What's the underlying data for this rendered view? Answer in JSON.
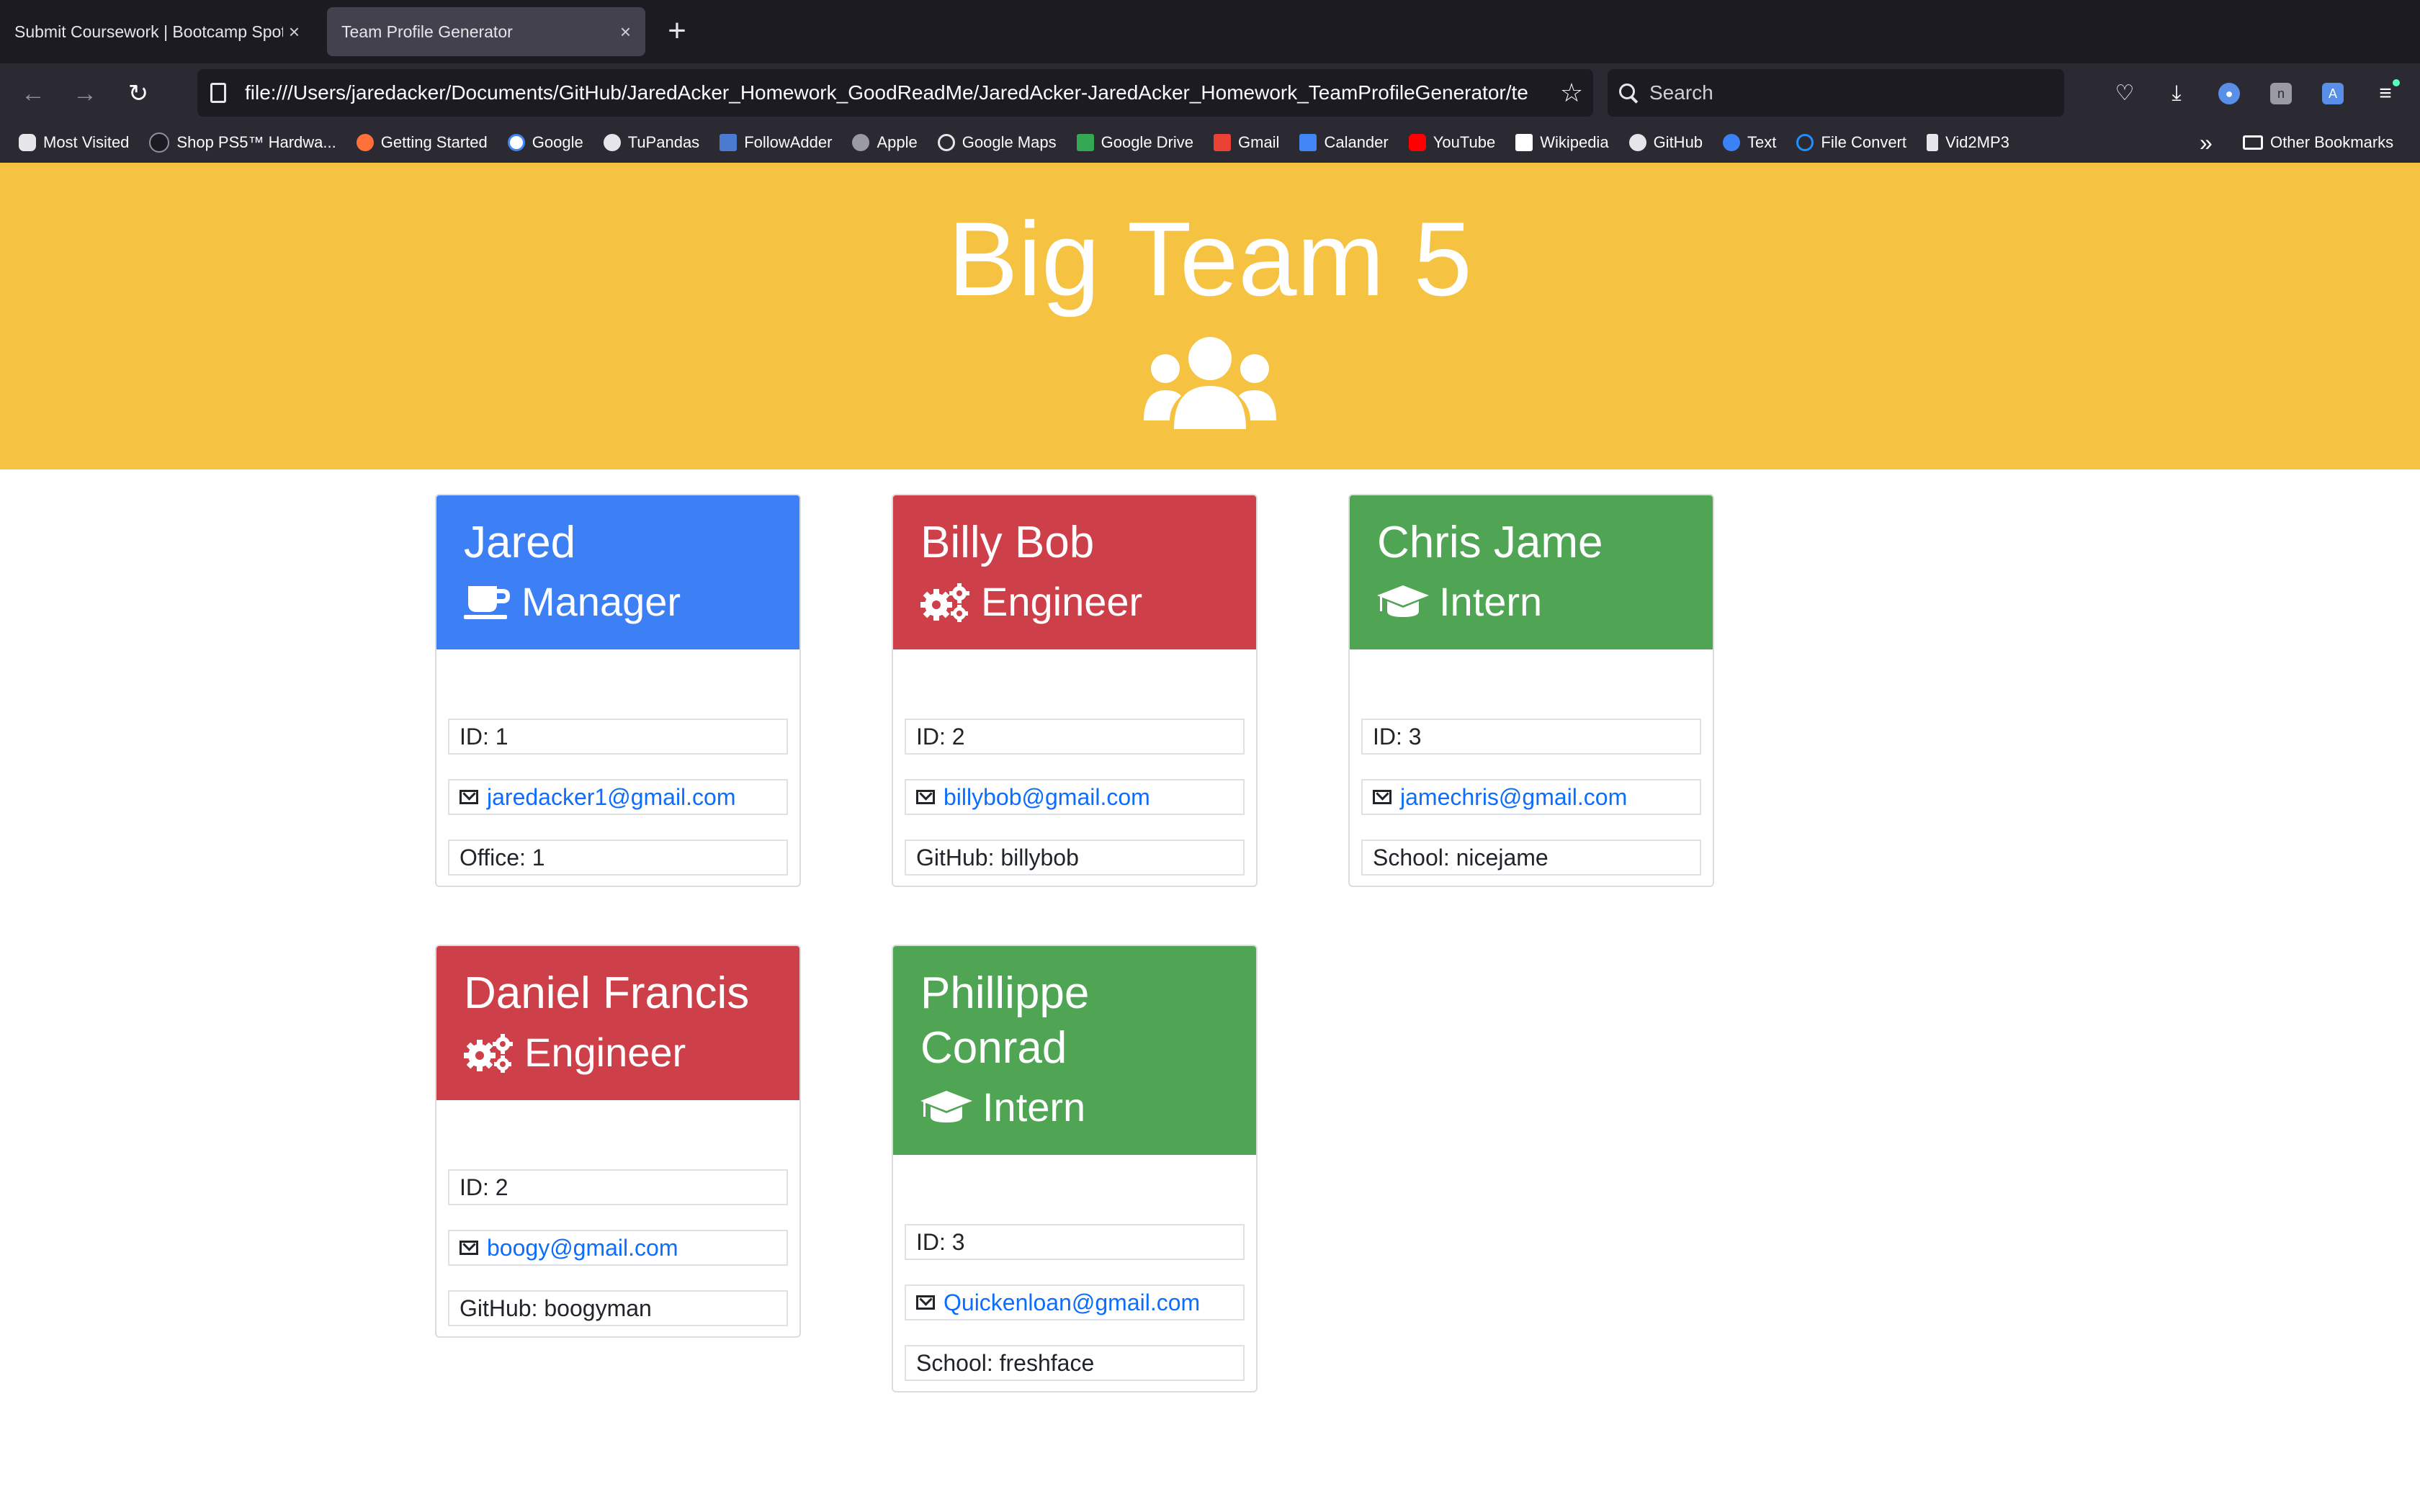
{
  "browser": {
    "tabs": [
      {
        "title": "Submit Coursework | Bootcamp Spot",
        "active": false
      },
      {
        "title": "Team Profile Generator",
        "active": true
      }
    ],
    "url": "file:///Users/jaredacker/Documents/GitHub/JaredAcker_Homework_GoodReadMe/JaredAcker-JaredAcker_Homework_TeamProfileGenerator/te",
    "search_placeholder": "Search",
    "bookmarks": [
      {
        "label": "Most Visited",
        "icon": "gear-icon",
        "color": "#e6e6ea"
      },
      {
        "label": "Shop PS5™ Hardwa...",
        "icon": "playstation-icon",
        "color": "#2b2a33"
      },
      {
        "label": "Getting Started",
        "icon": "firefox-icon",
        "color": "#ff7139"
      },
      {
        "label": "Google",
        "icon": "google-icon",
        "color": "#ffffff"
      },
      {
        "label": "TuPandas",
        "icon": "tupandas-icon",
        "color": "#e6e6ea"
      },
      {
        "label": "FollowAdder",
        "icon": "followadder-icon",
        "color": "#4a7bd0"
      },
      {
        "label": "Apple",
        "icon": "apple-icon",
        "color": "#9a9aa3"
      },
      {
        "label": "Google Maps",
        "icon": "globe-icon",
        "color": "#e6e6ea"
      },
      {
        "label": "Google Drive",
        "icon": "drive-icon",
        "color": "#34a853"
      },
      {
        "label": "Gmail",
        "icon": "gmail-icon",
        "color": "#ea4335"
      },
      {
        "label": "Calander",
        "icon": "calendar-icon",
        "color": "#4285f4"
      },
      {
        "label": "YouTube",
        "icon": "youtube-icon",
        "color": "#ff0000"
      },
      {
        "label": "Wikipedia",
        "icon": "wikipedia-icon",
        "color": "#ffffff"
      },
      {
        "label": "GitHub",
        "icon": "github-icon",
        "color": "#e6e6ea"
      },
      {
        "label": "Text",
        "icon": "message-icon",
        "color": "#3b82f6"
      },
      {
        "label": "File Convert",
        "icon": "convert-icon",
        "color": "#1e90ff"
      },
      {
        "label": "Vid2MP3",
        "icon": "music-icon",
        "color": "#e6e6ea"
      }
    ],
    "other_bookmarks": "Other Bookmarks"
  },
  "page": {
    "title": "Big Team 5",
    "header_color": "#f5c242"
  },
  "team": [
    {
      "name": "Jared",
      "role": "Manager",
      "role_icon": "coffee-mug-icon",
      "color": "#3d80f5",
      "id": "ID: 1",
      "email": "jaredacker1@gmail.com",
      "extra": "Office: 1"
    },
    {
      "name": "Billy Bob",
      "role": "Engineer",
      "role_icon": "cogs-icon",
      "color": "#cd3f49",
      "id": "ID: 2",
      "email": "billybob@gmail.com",
      "extra": "GitHub: billybob"
    },
    {
      "name": "Chris Jame",
      "role": "Intern",
      "role_icon": "graduation-cap-icon",
      "color": "#4fa553",
      "id": "ID: 3",
      "email": "jamechris@gmail.com",
      "extra": "School: nicejame"
    },
    {
      "name": "Daniel Francis",
      "role": "Engineer",
      "role_icon": "cogs-icon",
      "color": "#cd3f49",
      "id": "ID: 2",
      "email": "boogy@gmail.com",
      "extra": "GitHub: boogyman"
    },
    {
      "name": "Phillippe Conrad",
      "role": "Intern",
      "role_icon": "graduation-cap-icon",
      "color": "#4fa553",
      "id": "ID: 3",
      "email": "Quickenloan@gmail.com",
      "extra": "School: freshface"
    }
  ]
}
